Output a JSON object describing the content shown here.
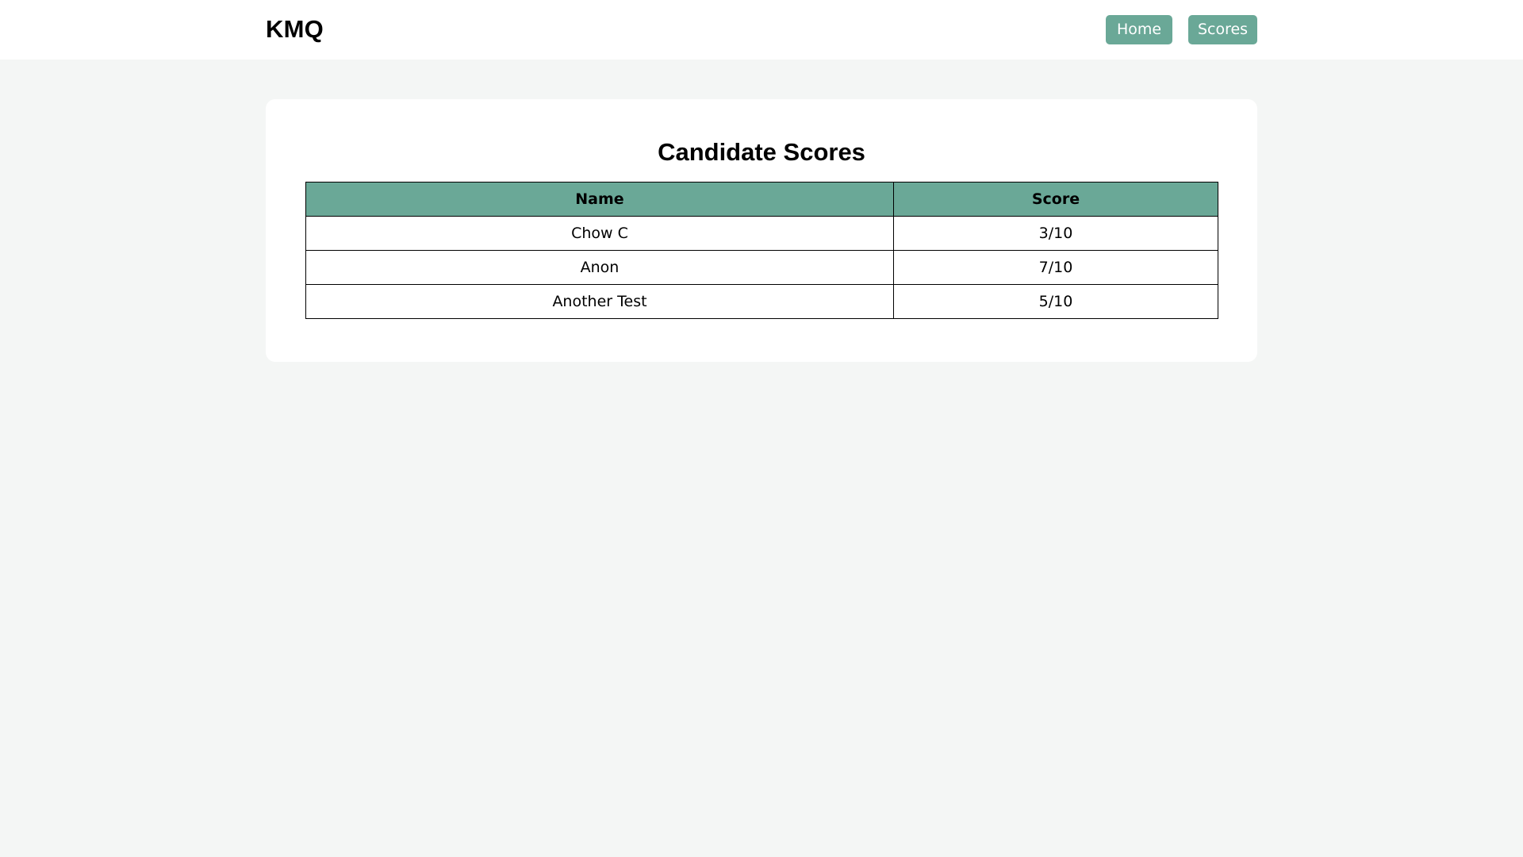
{
  "header": {
    "brand": "KMQ",
    "nav": {
      "home_label": "Home",
      "scores_label": "Scores"
    }
  },
  "main": {
    "title": "Candidate Scores",
    "table": {
      "columns": [
        "Name",
        "Score"
      ],
      "rows": [
        {
          "name": "Chow C",
          "score": "3/10"
        },
        {
          "name": "Anon",
          "score": "7/10"
        },
        {
          "name": "Another Test",
          "score": "5/10"
        }
      ]
    }
  },
  "colors": {
    "accent": "#6aa897",
    "page_background": "#f4f6f5",
    "surface": "#ffffff"
  }
}
